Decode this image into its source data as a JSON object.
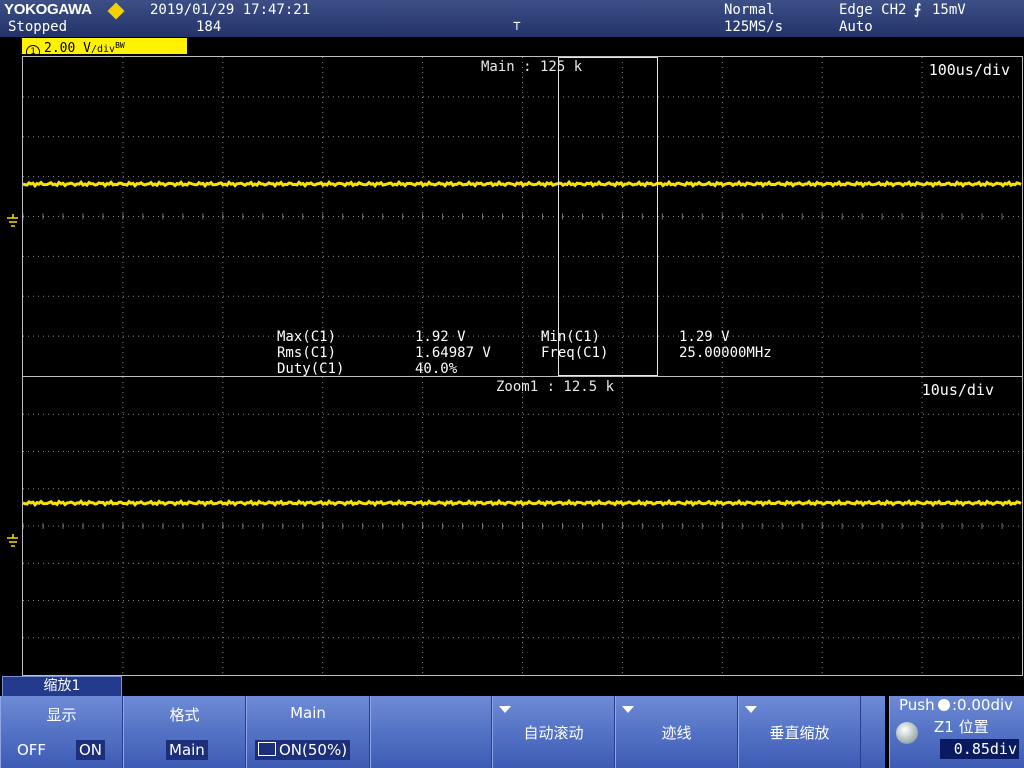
{
  "status": {
    "brand": "YOKOGAWA",
    "state": "Stopped",
    "datetime": "2019/01/29 17:47:21",
    "count": "184",
    "mode": "Normal",
    "sample_rate": "125MS/s",
    "trigger": "Edge CH2",
    "trigger_level": "15mV",
    "trigger_mode": "Auto"
  },
  "channel": {
    "number": "1",
    "scale": "2.00 V",
    "suffix": "/div",
    "bw_mark": "BW"
  },
  "main_view": {
    "label": "Main : 125 k",
    "timebase": "100us/div"
  },
  "zoom_view": {
    "label": "Zoom1 : 12.5 k",
    "timebase": "10us/div"
  },
  "measurements": {
    "max_label": "Max(C1)",
    "max_value": "1.92 V",
    "min_label": "Min(C1)",
    "min_value": "1.29 V",
    "rms_label": "Rms(C1)",
    "rms_value": "1.64987 V",
    "freq_label": "Freq(C1)",
    "freq_value": "25.00000MHz",
    "duty_label": "Duty(C1)",
    "duty_value": "40.0%"
  },
  "menu": {
    "tab": "缩放1",
    "display": {
      "title": "显示",
      "off": "OFF",
      "on": "ON"
    },
    "format": {
      "title": "格式",
      "value": "Main"
    },
    "main": {
      "title": "Main",
      "value": "ON(50%)"
    },
    "auto_scroll": "自动滚动",
    "trace": "迹线",
    "vertical_zoom": "垂直缩放"
  },
  "knob": {
    "push_label": "Push",
    "push_value": ":0.00div",
    "title": "Z1 位置",
    "value": "0.85div"
  },
  "colors": {
    "trace": "#f5e400",
    "grid": "#bfbfbf",
    "menu": "#4f6ec4",
    "topbar": "#2b3c78"
  }
}
